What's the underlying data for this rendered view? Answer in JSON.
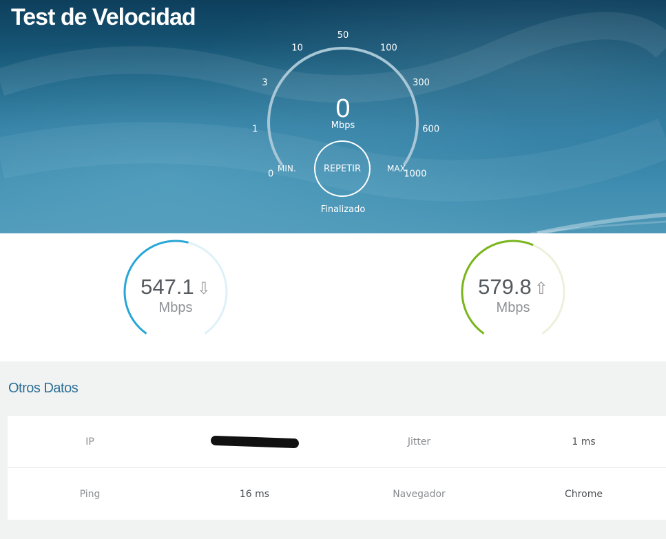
{
  "header": {
    "title": "Test de Velocidad"
  },
  "gauge": {
    "scale_labels": [
      "0",
      "1",
      "3",
      "10",
      "50",
      "100",
      "300",
      "600",
      "1000"
    ],
    "current_value": "0",
    "unit": "Mbps",
    "min_label": "MIN.",
    "max_label": "MAX.",
    "repeat_label": "REPETIR",
    "status": "Finalizado"
  },
  "results": {
    "download": {
      "value": "547.1",
      "unit": "Mbps",
      "arrow": "⇩",
      "color": "#29a6d6",
      "fraction": 0.55
    },
    "upload": {
      "value": "579.8",
      "unit": "Mbps",
      "arrow": "⇧",
      "color": "#79b51c",
      "fraction": 0.58
    }
  },
  "other_data": {
    "title": "Otros Datos",
    "rows": [
      {
        "label1": "IP",
        "value1": "",
        "label2": "Jitter",
        "value2": "1 ms"
      },
      {
        "label1": "Ping",
        "value1": "16 ms",
        "label2": "Navegador",
        "value2": "Chrome"
      }
    ]
  },
  "colors": {
    "title_blue": "#2a6f95",
    "background": "#f1f2f2"
  },
  "icons": {
    "download": "arrow-down-icon",
    "upload": "arrow-up-icon"
  }
}
